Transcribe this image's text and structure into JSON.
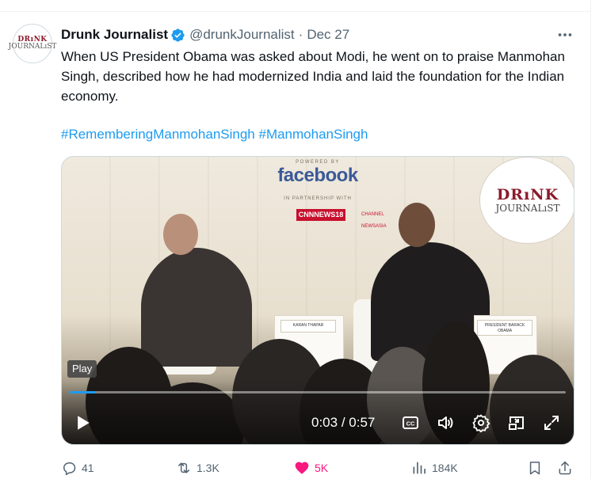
{
  "tweet": {
    "author_name": "Drunk Journalist",
    "handle": "@drunkJournalist",
    "separator": "·",
    "date": "Dec 27",
    "text": "When US President Obama was asked about Modi, he went on to praise Manmohan Singh, described how he had modernized India and laid the foundation for the Indian economy.",
    "hashtags": [
      "#RememberingManmohanSingh",
      "#ManmohanSingh"
    ],
    "avatar_text_line1": "DRıNK",
    "avatar_text_line2": "JOURNALıST"
  },
  "video": {
    "stage_powered": "POWERED BY",
    "stage_sponsor": "facebook",
    "stage_partnership": "IN PARTNERSHIP WITH",
    "stage_partner1": "CNNNEWS18",
    "stage_partner2": "CHANNEL NEWSASIA",
    "watermark_line1": "DRıNK",
    "watermark_line2": "JOURNALıST",
    "placard_left": "KARAN THAPAR",
    "placard_right": "PRESIDENT BARACK OBAMA",
    "play_tooltip": "Play",
    "current_time": "0:03",
    "time_separator": " / ",
    "duration": "0:57",
    "progress_fraction": 0.053
  },
  "actions": {
    "replies": "41",
    "reposts": "1.3K",
    "likes": "5K",
    "views": "184K"
  },
  "colors": {
    "accent": "#1d9bf0",
    "like": "#f91880",
    "muted": "#536471"
  }
}
